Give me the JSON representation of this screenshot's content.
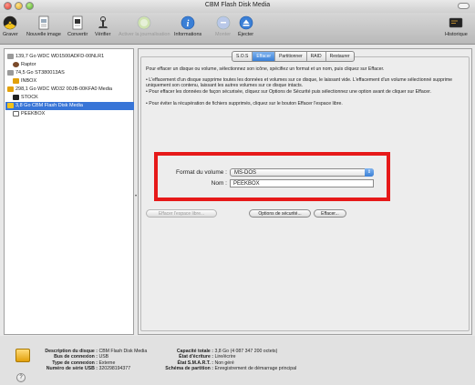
{
  "window": {
    "title": "CBM Flash Disk Media"
  },
  "toolbar": {
    "items": [
      {
        "label": "Graver",
        "icon": "burn-icon",
        "disabled": false
      },
      {
        "label": "Nouvelle image",
        "icon": "new-image-icon",
        "disabled": false
      },
      {
        "label": "Convertir",
        "icon": "convert-icon",
        "disabled": false
      },
      {
        "label": "Vérifier",
        "icon": "verify-icon",
        "disabled": false
      },
      {
        "label": "Activer la journalisation",
        "icon": "journaling-icon",
        "disabled": true
      },
      {
        "label": "Informations",
        "icon": "info-icon",
        "disabled": false
      },
      {
        "label": "Monter",
        "icon": "mount-icon",
        "disabled": true
      },
      {
        "label": "Éjecter",
        "icon": "eject-icon",
        "disabled": false
      },
      {
        "label": "Historique",
        "icon": "log-icon",
        "disabled": false
      }
    ]
  },
  "sidebar": {
    "items": [
      {
        "label": "139,7 Go WDC WD1500ADFD-00NLR1",
        "level": 0,
        "icon": "hard-disk-icon"
      },
      {
        "label": "Raptor",
        "level": 1,
        "icon": "volume-icon"
      },
      {
        "label": "74,5 Go ST380013AS",
        "level": 0,
        "icon": "hard-disk-icon"
      },
      {
        "label": "INBOX",
        "level": 1,
        "icon": "volume-icon"
      },
      {
        "label": "298,1 Go WDC WD32 00JB-00KFA0 Media",
        "level": 0,
        "icon": "external-disk-icon"
      },
      {
        "label": "STOCK",
        "level": 1,
        "icon": "volume-icon"
      },
      {
        "label": "3,8 Go CBM Flash Disk Media",
        "level": 0,
        "icon": "flash-disk-icon",
        "selected": true
      },
      {
        "label": "PEEKBOX",
        "level": 1,
        "icon": "volume-icon"
      }
    ]
  },
  "tabs": [
    {
      "label": "S.O.S",
      "active": false
    },
    {
      "label": "Effacer",
      "active": true
    },
    {
      "label": "Partitionner",
      "active": false
    },
    {
      "label": "RAID",
      "active": false
    },
    {
      "label": "Restaurer",
      "active": false
    }
  ],
  "erase": {
    "intro": "Pour effacer un disque ou volume, sélectionnez son icône, spécifiez un format et un nom, puis cliquez sur Effacer.",
    "bullets": [
      "• L'effacement d'un disque supprime toutes les données et volumes sur ce disque, le laissant vide. L'effacement d'un volume sélectionné supprime uniquement son contenu, laissant les autres volumes sur ce disque intacts.",
      "• Pour effacer les données de façon sécurisée, cliquez sur Options de Sécurité puis sélectionnez une option avant de cliquer sur Effacer.",
      "• Pour éviter la récupération de fichiers supprimés, cliquez sur le bouton Effacer l'espace libre."
    ],
    "format_label": "Format du volume :",
    "format_value": "MS-DOS",
    "name_label": "Nom :",
    "name_value": "PEEKBOX",
    "btn_free_space": "Effacer l'espace libre...",
    "btn_security": "Options de sécurité...",
    "btn_erase": "Effacer..."
  },
  "info": {
    "left": [
      {
        "k": "Description du disque :",
        "v": "CBM Flash Disk Media"
      },
      {
        "k": "Bus de connexion :",
        "v": "USB"
      },
      {
        "k": "Type de connexion :",
        "v": "Externe"
      },
      {
        "k": "Numéro de série USB :",
        "v": "320298194377"
      }
    ],
    "right": [
      {
        "k": "Capacité totale :",
        "v": "3,8 Go (4 087 347 200 octets)"
      },
      {
        "k": "État d'écriture :",
        "v": "Lire/écrire"
      },
      {
        "k": "État S.M.A.R.T. :",
        "v": "Non géré"
      },
      {
        "k": "Schéma de partition :",
        "v": "Enregistrement de démarrage principal"
      }
    ]
  },
  "help_label": "?"
}
